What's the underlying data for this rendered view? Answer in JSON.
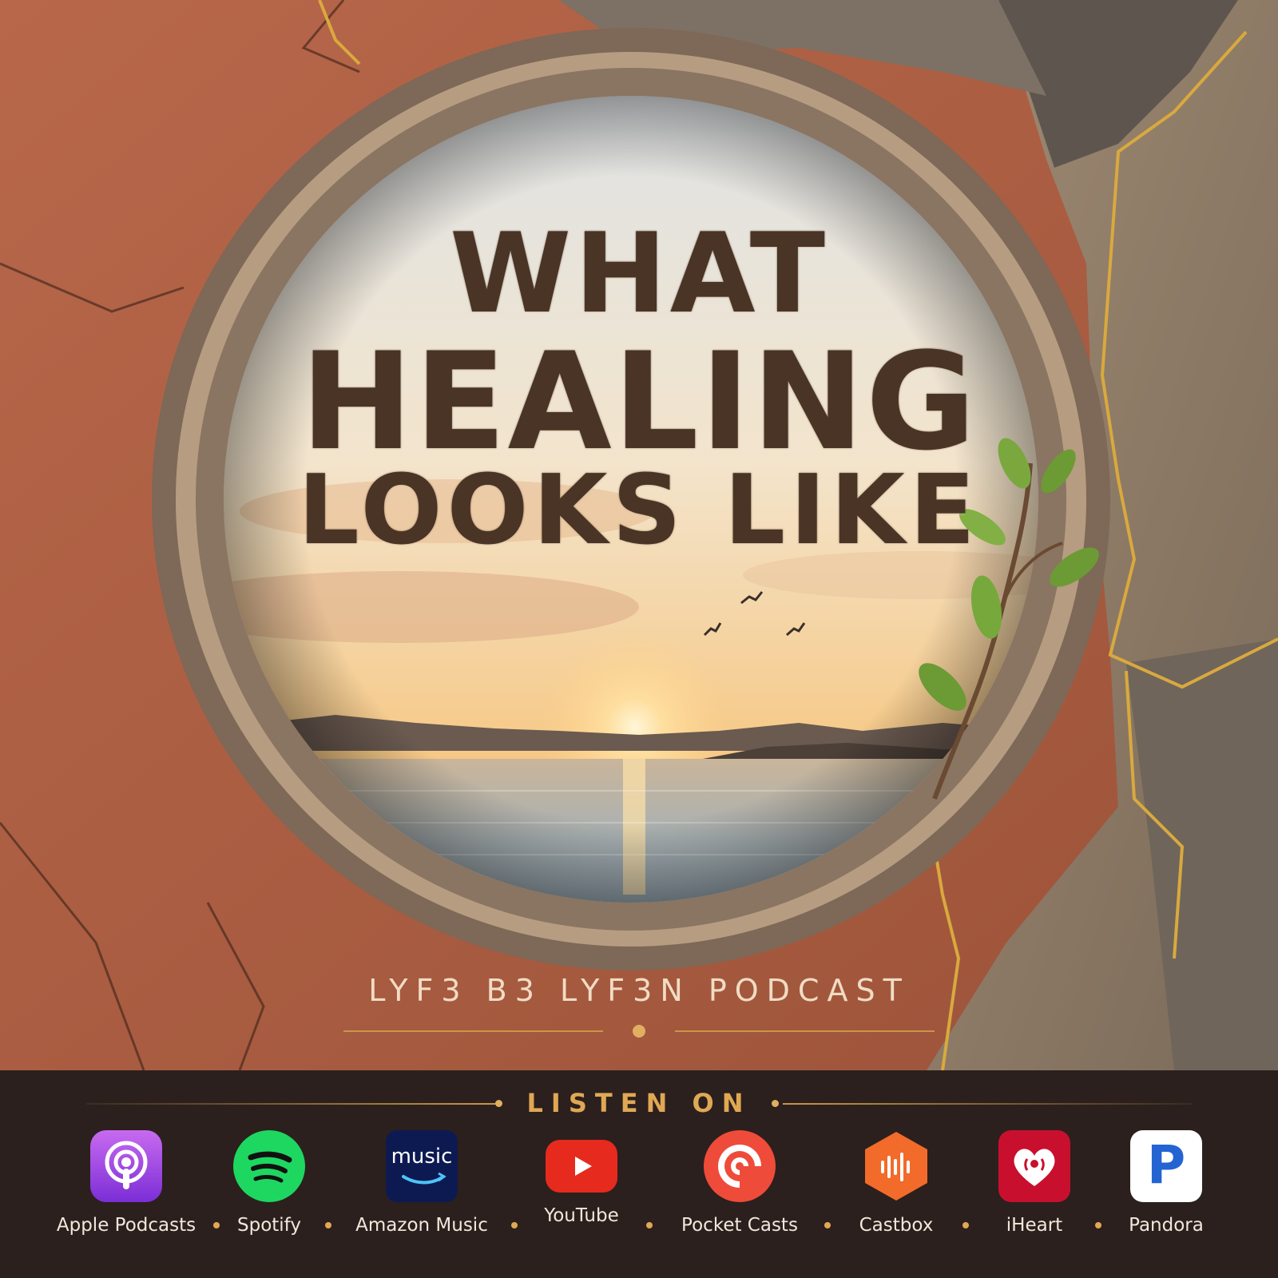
{
  "cover": {
    "title_line1": "WHAT",
    "title_line2": "HEALING",
    "title_line3": "LOOKS LIKE",
    "podcast_name": "LYF3 B3 LYF3N PODCAST"
  },
  "listen_on": {
    "heading": "LISTEN ON",
    "platforms": [
      {
        "label": "Apple Podcasts",
        "icon": "apple-podcasts-icon"
      },
      {
        "label": "Spotify",
        "icon": "spotify-icon"
      },
      {
        "label": "Amazon Music",
        "icon": "amazon-music-icon",
        "icon_text": "music"
      },
      {
        "label": "YouTube",
        "icon": "youtube-icon"
      },
      {
        "label": "Pocket Casts",
        "icon": "pocket-casts-icon"
      },
      {
        "label": "Castbox",
        "icon": "castbox-icon"
      },
      {
        "label": "iHeart",
        "icon": "iheart-icon"
      },
      {
        "label": "Pandora",
        "icon": "pandora-icon",
        "icon_text": "P"
      }
    ]
  },
  "colors": {
    "title": "#4a3425",
    "accent_gold": "#e0a854",
    "footer_bg": "#2b201d",
    "clay": "#b8674a"
  }
}
